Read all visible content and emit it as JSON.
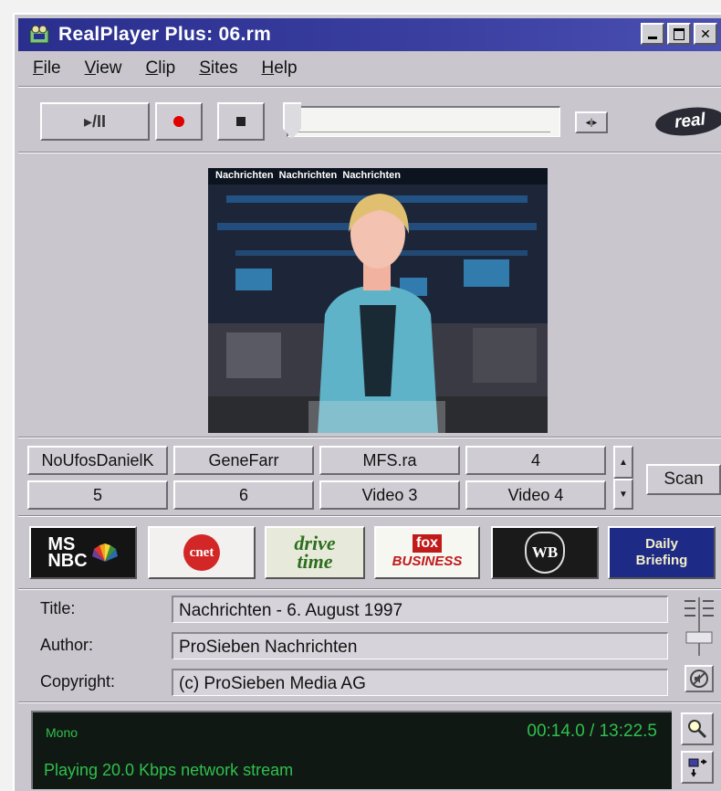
{
  "window": {
    "title": "RealPlayer Plus: 06.rm"
  },
  "menu": [
    {
      "mnemonic": "F",
      "rest": "ile"
    },
    {
      "mnemonic": "V",
      "rest": "iew"
    },
    {
      "mnemonic": "C",
      "rest": "lip"
    },
    {
      "mnemonic": "S",
      "rest": "ites"
    },
    {
      "mnemonic": "H",
      "rest": "elp"
    }
  ],
  "controls": {
    "play_pause": "▸/II",
    "logo": "real"
  },
  "video": {
    "overlay_text": "Nachrichten  Nachrichten  Nachrichten"
  },
  "presets": {
    "row1": [
      "NoUfosDanielK",
      "GeneFarr",
      "MFS.ra",
      "4"
    ],
    "row2": [
      "5",
      "6",
      "Video 3",
      "Video 4"
    ],
    "scan": "Scan"
  },
  "channels": {
    "msnbc": [
      "MS",
      "NBC"
    ],
    "cnet": "cnet",
    "drivetime": [
      "drive",
      "time"
    ],
    "foxbusiness": [
      "fox",
      "BUSINESS"
    ],
    "wb": "WB",
    "daily": [
      "Daily",
      "Briefing"
    ]
  },
  "info": {
    "title_label": "Title:",
    "title_value": "Nachrichten - 6. August 1997",
    "author_label": "Author:",
    "author_value": "ProSieben Nachrichten",
    "copyright_label": "Copyright:",
    "copyright_value": "(c) ProSieben Media AG"
  },
  "status": {
    "channel_mode": "Mono",
    "time": "00:14.0 / 13:22.5",
    "message": "Playing 20.0 Kbps network stream"
  },
  "colors": {
    "titlebar": "#2a2f8e",
    "status_text": "#2fc04b",
    "record": "#e00000"
  }
}
